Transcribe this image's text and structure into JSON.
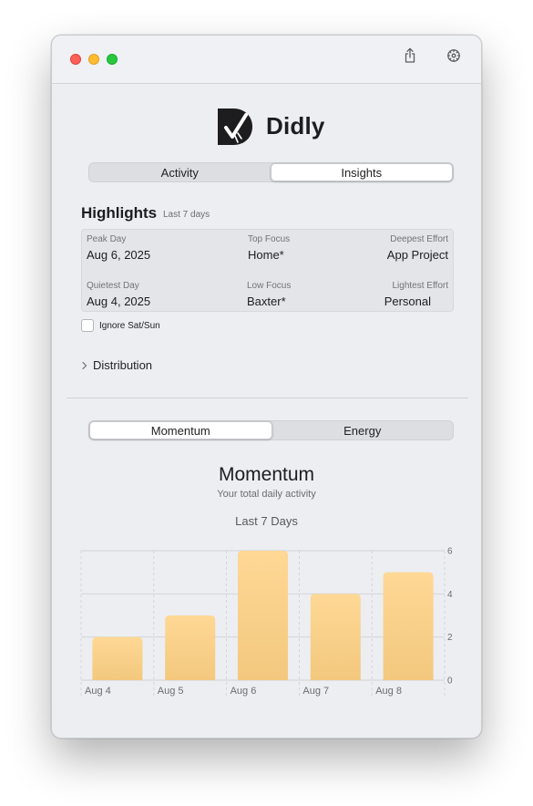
{
  "app": {
    "name": "Didly"
  },
  "titlebar": {
    "icons": [
      "share-icon",
      "gear-icon"
    ]
  },
  "main_tabs": {
    "items": [
      {
        "label": "Activity",
        "active": false
      },
      {
        "label": "Insights",
        "active": true
      }
    ]
  },
  "highlights": {
    "title": "Highlights",
    "subtitle": "Last 7 days",
    "stats": {
      "peak_day": {
        "label": "Peak Day",
        "value": "Aug 6, 2025"
      },
      "top_focus": {
        "label": "Top Focus",
        "value": "Home*"
      },
      "deepest_effort": {
        "label": "Deepest Effort",
        "value": "App Project"
      },
      "quietest_day": {
        "label": "Quietest Day",
        "value": "Aug 4, 2025"
      },
      "low_focus": {
        "label": "Low Focus",
        "value": "Baxter*"
      },
      "lightest_effort": {
        "label": "Lightest Effort",
        "value": "Personal"
      }
    },
    "ignore_weekends": {
      "label": "Ignore Sat/Sun",
      "checked": false
    },
    "distribution": {
      "label": "Distribution",
      "expanded": false
    }
  },
  "chart_tabs": {
    "items": [
      {
        "label": "Momentum",
        "active": true
      },
      {
        "label": "Energy",
        "active": false
      }
    ]
  },
  "chart_section": {
    "title": "Momentum",
    "subtitle": "Your total daily activity",
    "range_label": "Last 7 Days"
  },
  "colors": {
    "bar_top": "#fed895",
    "bar_bottom": "#f3c87e",
    "grid": "#cfd1d5",
    "accent_window": "#eceef1"
  },
  "chart_data": {
    "type": "bar",
    "categories": [
      "Aug 4",
      "Aug 5",
      "Aug 6",
      "Aug 7",
      "Aug 8"
    ],
    "values": [
      2,
      3,
      6,
      4,
      5
    ],
    "title": "Momentum",
    "subtitle": "Your total daily activity",
    "ylim": [
      0,
      6
    ],
    "yticks": [
      0,
      2,
      4,
      6
    ],
    "y_axis_position": "right",
    "grid": true
  }
}
